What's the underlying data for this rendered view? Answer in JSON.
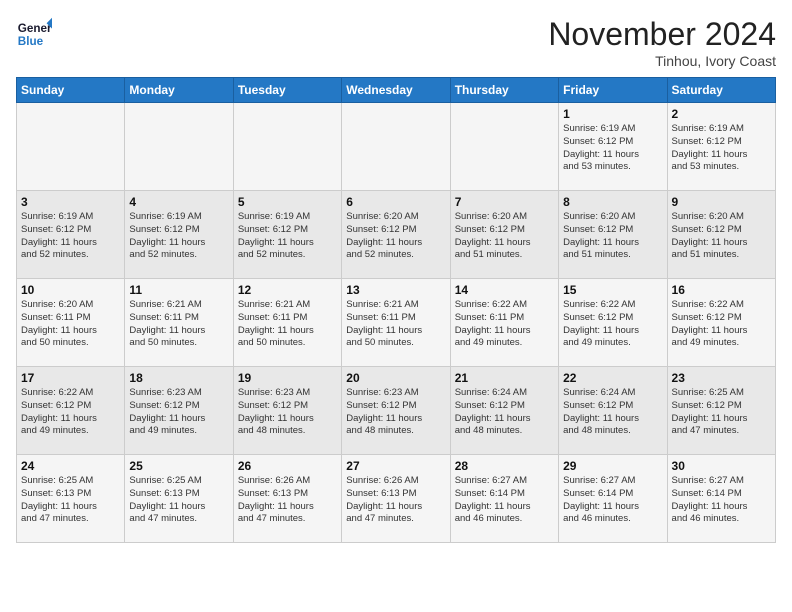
{
  "header": {
    "logo_line1": "General",
    "logo_line2": "Blue",
    "month": "November 2024",
    "location": "Tinhou, Ivory Coast"
  },
  "days_of_week": [
    "Sunday",
    "Monday",
    "Tuesday",
    "Wednesday",
    "Thursday",
    "Friday",
    "Saturday"
  ],
  "weeks": [
    [
      {
        "day": "",
        "info": ""
      },
      {
        "day": "",
        "info": ""
      },
      {
        "day": "",
        "info": ""
      },
      {
        "day": "",
        "info": ""
      },
      {
        "day": "",
        "info": ""
      },
      {
        "day": "1",
        "info": "Sunrise: 6:19 AM\nSunset: 6:12 PM\nDaylight: 11 hours\nand 53 minutes."
      },
      {
        "day": "2",
        "info": "Sunrise: 6:19 AM\nSunset: 6:12 PM\nDaylight: 11 hours\nand 53 minutes."
      }
    ],
    [
      {
        "day": "3",
        "info": "Sunrise: 6:19 AM\nSunset: 6:12 PM\nDaylight: 11 hours\nand 52 minutes."
      },
      {
        "day": "4",
        "info": "Sunrise: 6:19 AM\nSunset: 6:12 PM\nDaylight: 11 hours\nand 52 minutes."
      },
      {
        "day": "5",
        "info": "Sunrise: 6:19 AM\nSunset: 6:12 PM\nDaylight: 11 hours\nand 52 minutes."
      },
      {
        "day": "6",
        "info": "Sunrise: 6:20 AM\nSunset: 6:12 PM\nDaylight: 11 hours\nand 52 minutes."
      },
      {
        "day": "7",
        "info": "Sunrise: 6:20 AM\nSunset: 6:12 PM\nDaylight: 11 hours\nand 51 minutes."
      },
      {
        "day": "8",
        "info": "Sunrise: 6:20 AM\nSunset: 6:12 PM\nDaylight: 11 hours\nand 51 minutes."
      },
      {
        "day": "9",
        "info": "Sunrise: 6:20 AM\nSunset: 6:12 PM\nDaylight: 11 hours\nand 51 minutes."
      }
    ],
    [
      {
        "day": "10",
        "info": "Sunrise: 6:20 AM\nSunset: 6:11 PM\nDaylight: 11 hours\nand 50 minutes."
      },
      {
        "day": "11",
        "info": "Sunrise: 6:21 AM\nSunset: 6:11 PM\nDaylight: 11 hours\nand 50 minutes."
      },
      {
        "day": "12",
        "info": "Sunrise: 6:21 AM\nSunset: 6:11 PM\nDaylight: 11 hours\nand 50 minutes."
      },
      {
        "day": "13",
        "info": "Sunrise: 6:21 AM\nSunset: 6:11 PM\nDaylight: 11 hours\nand 50 minutes."
      },
      {
        "day": "14",
        "info": "Sunrise: 6:22 AM\nSunset: 6:11 PM\nDaylight: 11 hours\nand 49 minutes."
      },
      {
        "day": "15",
        "info": "Sunrise: 6:22 AM\nSunset: 6:12 PM\nDaylight: 11 hours\nand 49 minutes."
      },
      {
        "day": "16",
        "info": "Sunrise: 6:22 AM\nSunset: 6:12 PM\nDaylight: 11 hours\nand 49 minutes."
      }
    ],
    [
      {
        "day": "17",
        "info": "Sunrise: 6:22 AM\nSunset: 6:12 PM\nDaylight: 11 hours\nand 49 minutes."
      },
      {
        "day": "18",
        "info": "Sunrise: 6:23 AM\nSunset: 6:12 PM\nDaylight: 11 hours\nand 49 minutes."
      },
      {
        "day": "19",
        "info": "Sunrise: 6:23 AM\nSunset: 6:12 PM\nDaylight: 11 hours\nand 48 minutes."
      },
      {
        "day": "20",
        "info": "Sunrise: 6:23 AM\nSunset: 6:12 PM\nDaylight: 11 hours\nand 48 minutes."
      },
      {
        "day": "21",
        "info": "Sunrise: 6:24 AM\nSunset: 6:12 PM\nDaylight: 11 hours\nand 48 minutes."
      },
      {
        "day": "22",
        "info": "Sunrise: 6:24 AM\nSunset: 6:12 PM\nDaylight: 11 hours\nand 48 minutes."
      },
      {
        "day": "23",
        "info": "Sunrise: 6:25 AM\nSunset: 6:12 PM\nDaylight: 11 hours\nand 47 minutes."
      }
    ],
    [
      {
        "day": "24",
        "info": "Sunrise: 6:25 AM\nSunset: 6:13 PM\nDaylight: 11 hours\nand 47 minutes."
      },
      {
        "day": "25",
        "info": "Sunrise: 6:25 AM\nSunset: 6:13 PM\nDaylight: 11 hours\nand 47 minutes."
      },
      {
        "day": "26",
        "info": "Sunrise: 6:26 AM\nSunset: 6:13 PM\nDaylight: 11 hours\nand 47 minutes."
      },
      {
        "day": "27",
        "info": "Sunrise: 6:26 AM\nSunset: 6:13 PM\nDaylight: 11 hours\nand 47 minutes."
      },
      {
        "day": "28",
        "info": "Sunrise: 6:27 AM\nSunset: 6:14 PM\nDaylight: 11 hours\nand 46 minutes."
      },
      {
        "day": "29",
        "info": "Sunrise: 6:27 AM\nSunset: 6:14 PM\nDaylight: 11 hours\nand 46 minutes."
      },
      {
        "day": "30",
        "info": "Sunrise: 6:27 AM\nSunset: 6:14 PM\nDaylight: 11 hours\nand 46 minutes."
      }
    ]
  ]
}
